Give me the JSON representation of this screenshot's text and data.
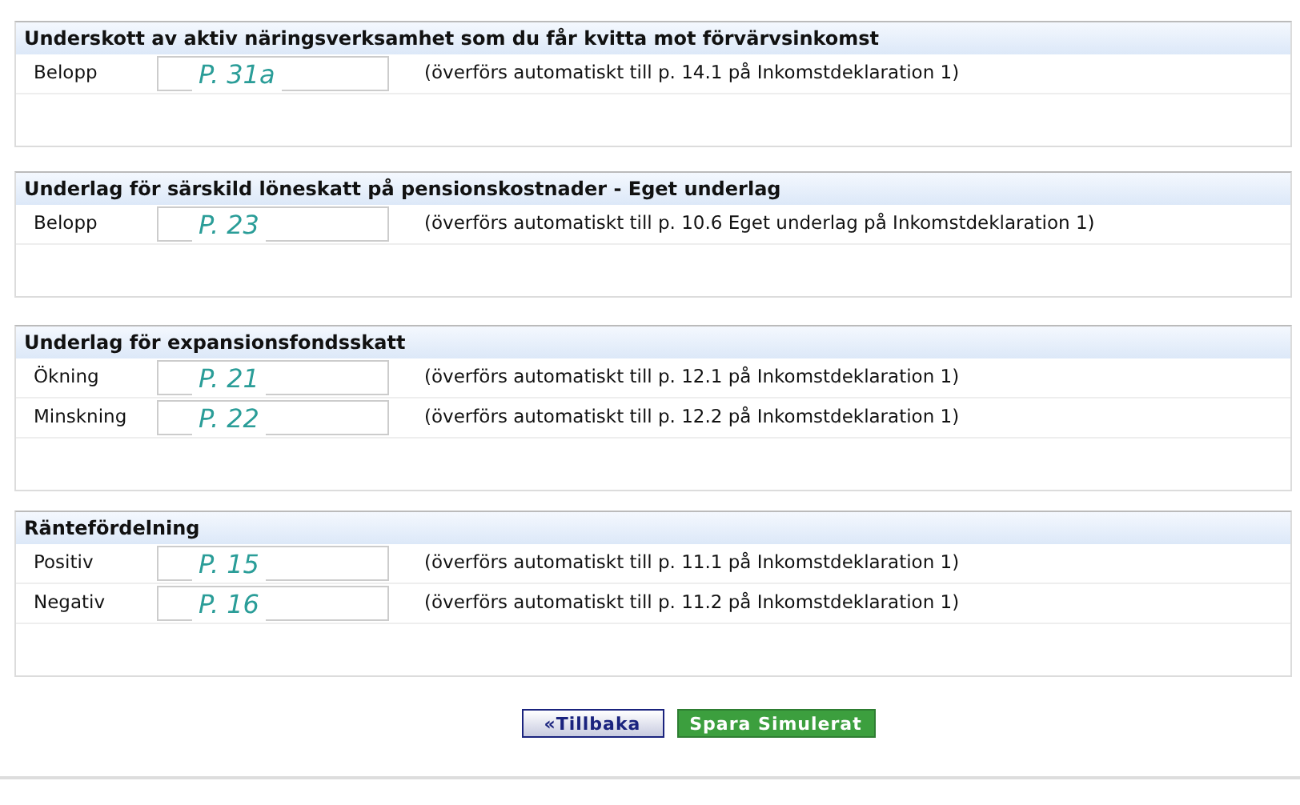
{
  "sections": [
    {
      "title": "Underskott av aktiv näringsverksamhet som du får kvitta mot förvärvsinkomst",
      "rows": [
        {
          "label": "Belopp",
          "annotation": "P. 31a",
          "note": "(överförs automatiskt till p. 14.1 på Inkomstdeklaration 1)"
        }
      ]
    },
    {
      "title": "Underlag för särskild löneskatt på pensionskostnader - Eget underlag",
      "rows": [
        {
          "label": "Belopp",
          "annotation": "P. 23",
          "note": "(överförs automatiskt till p. 10.6 Eget underlag på Inkomstdeklaration 1)"
        }
      ]
    },
    {
      "title": "Underlag för expansionsfondsskatt",
      "rows": [
        {
          "label": "Ökning",
          "annotation": "P. 21",
          "note": "(överförs automatiskt till p. 12.1 på Inkomstdeklaration 1)"
        },
        {
          "label": "Minskning",
          "annotation": "P. 22",
          "note": "(överförs automatiskt till p. 12.2 på Inkomstdeklaration 1)"
        }
      ]
    },
    {
      "title": "Räntefördelning",
      "rows": [
        {
          "label": "Positiv",
          "annotation": "P. 15",
          "note": "(överförs automatiskt till p. 11.1 på Inkomstdeklaration 1)"
        },
        {
          "label": "Negativ",
          "annotation": "P. 16",
          "note": "(överförs automatiskt till p. 11.2 på Inkomstdeklaration 1)"
        }
      ]
    }
  ],
  "buttons": {
    "back": "«Tillbaka",
    "save": "Spara Simulerat"
  }
}
